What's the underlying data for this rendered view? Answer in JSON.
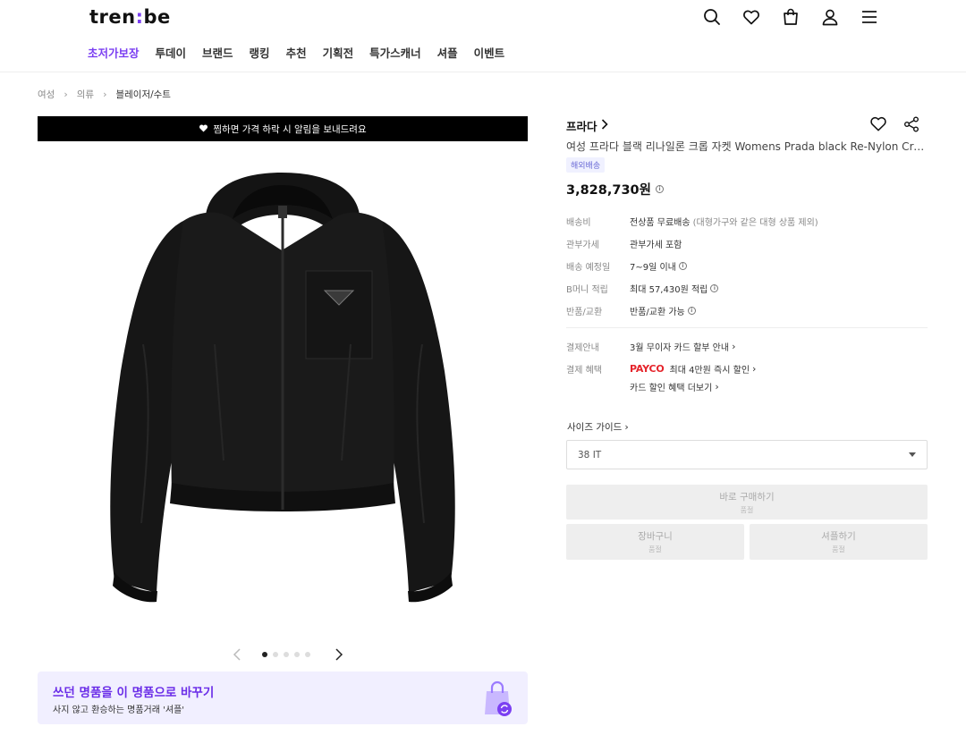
{
  "header": {
    "logo_prefix": "tren",
    "logo_colon": ":",
    "logo_suffix": "be",
    "icons": [
      "search-icon",
      "heart-icon",
      "bag-icon",
      "user-icon",
      "menu-icon"
    ],
    "nav": [
      "초저가보장",
      "투데이",
      "브랜드",
      "랭킹",
      "추천",
      "기획전",
      "특가스캐너",
      "셔플",
      "이벤트"
    ],
    "active_nav": "초저가보장",
    "accent_color": "#7b3ff2"
  },
  "breadcrumb": [
    "여성",
    "의류",
    "블레이저/수트"
  ],
  "wish_banner": "찜하면 가격 하락 시 알림을 보내드려요",
  "carousel": {
    "total": 5,
    "current": 1
  },
  "sell_banner": {
    "title": "쓰던 명품을 이 명품으로 바꾸기",
    "subtitle": "사지 않고 환승하는 명품거래 '셔플'"
  },
  "product": {
    "brand": "프라다",
    "title": "여성 프라다 블랙 리나일론 크롭 자켓 Womens Prada black Re-Nylon Cropped Jacket",
    "ship_badge": "해외배송",
    "price": "3,828,730원"
  },
  "info": {
    "shipping_label": "배송비",
    "shipping_value": "전상품 무료배송",
    "shipping_note": "(대형가구와 같은 대형 상품 제외)",
    "tax_label": "관부가세",
    "tax_value": "관부가세 포함",
    "eta_label": "배송 예정일",
    "eta_value": "7~9일 이내",
    "point_label": "B머니 적립",
    "point_value": "최대 57,430원 적립",
    "return_label": "반품/교환",
    "return_value": "반품/교환 가능",
    "payment_label": "결제안내",
    "payment_value": "3월 무이자 카드 할부 안내",
    "benefit_label": "결제 혜택",
    "payco_logo": "PAYCO",
    "benefit_value": "최대 4만원 즉시 할인",
    "card_more": "카드 할인 혜택 더보기"
  },
  "size": {
    "guide_label": "사이즈 가이드",
    "selected": "38 IT"
  },
  "buttons": {
    "buy_now": "바로 구매하기",
    "buy_now_sub": "품절",
    "cart": "장바구니",
    "cart_sub": "품절",
    "shuffle": "셔플하기",
    "shuffle_sub": "품절"
  }
}
